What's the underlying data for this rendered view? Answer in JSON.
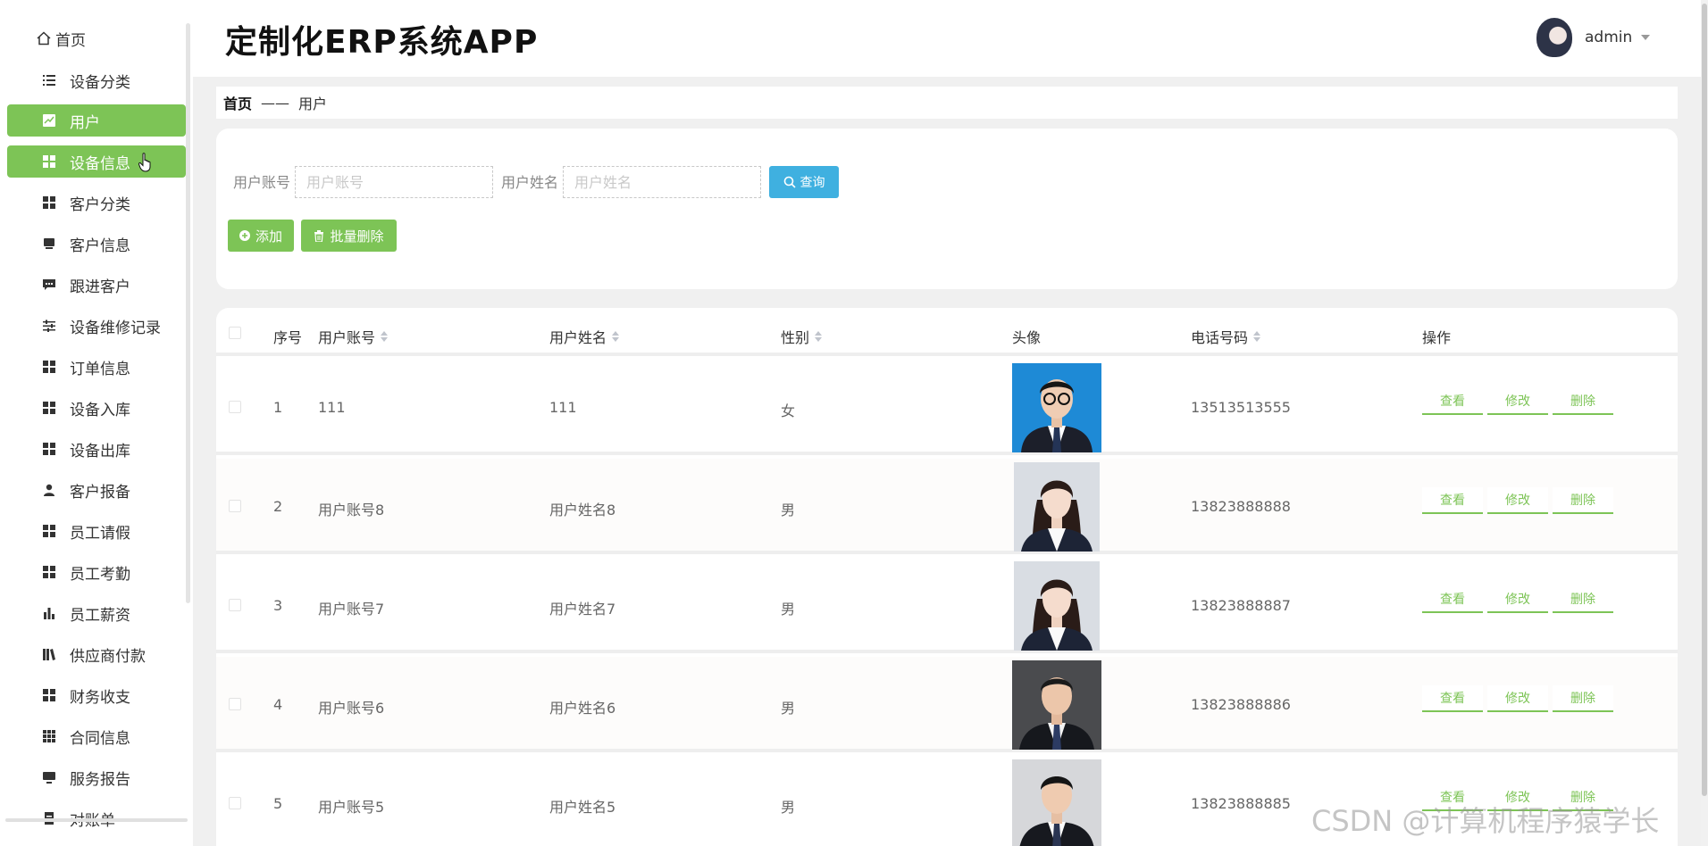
{
  "sidebar": {
    "home_label": "首页",
    "items": [
      {
        "label": "设备分类",
        "icon": "list-icon",
        "active": false
      },
      {
        "label": "用户",
        "icon": "chart-icon",
        "active": true
      },
      {
        "label": "设备信息",
        "icon": "grid-icon",
        "active": true
      },
      {
        "label": "客户分类",
        "icon": "grid-icon",
        "active": false
      },
      {
        "label": "客户信息",
        "icon": "inbox-icon",
        "active": false
      },
      {
        "label": "跟进客户",
        "icon": "message-icon",
        "active": false
      },
      {
        "label": "设备维修记录",
        "icon": "sliders-icon",
        "active": false
      },
      {
        "label": "订单信息",
        "icon": "grid-icon",
        "active": false
      },
      {
        "label": "设备入库",
        "icon": "grid-icon",
        "active": false
      },
      {
        "label": "设备出库",
        "icon": "grid-icon",
        "active": false
      },
      {
        "label": "客户报备",
        "icon": "person-icon",
        "active": false
      },
      {
        "label": "员工请假",
        "icon": "grid-icon",
        "active": false
      },
      {
        "label": "员工考勤",
        "icon": "grid-icon",
        "active": false
      },
      {
        "label": "员工薪资",
        "icon": "bar-chart-icon",
        "active": false
      },
      {
        "label": "供应商付款",
        "icon": "books-icon",
        "active": false
      },
      {
        "label": "财务收支",
        "icon": "grid-icon",
        "active": false
      },
      {
        "label": "合同信息",
        "icon": "apps-icon",
        "active": false
      },
      {
        "label": "服务报告",
        "icon": "monitor-icon",
        "active": false
      },
      {
        "label": "对账单",
        "icon": "document-icon",
        "active": false
      }
    ]
  },
  "header": {
    "title": "定制化ERP系统APP",
    "username": "admin"
  },
  "breadcrumb": {
    "home": "首页",
    "separator": "——",
    "current": "用户"
  },
  "search": {
    "account_label": "用户账号",
    "account_placeholder": "用户账号",
    "name_label": "用户姓名",
    "name_placeholder": "用户姓名",
    "query_label": "查询",
    "add_label": "添加",
    "batch_delete_label": "批量删除"
  },
  "table": {
    "columns": [
      "序号",
      "用户账号",
      "用户姓名",
      "性别",
      "头像",
      "电话号码",
      "操作"
    ],
    "sortable": [
      false,
      true,
      true,
      true,
      false,
      true,
      false
    ],
    "actions": {
      "view": "查看",
      "edit": "修改",
      "delete": "删除"
    },
    "rows": [
      {
        "index": "1",
        "account": "111",
        "name": "111",
        "gender": "女",
        "phone": "13513513555",
        "avatar": "blue-background-man-glasses"
      },
      {
        "index": "2",
        "account": "用户账号8",
        "name": "用户姓名8",
        "gender": "男",
        "phone": "13823888888",
        "avatar": "grey-background-woman"
      },
      {
        "index": "3",
        "account": "用户账号7",
        "name": "用户姓名7",
        "gender": "男",
        "phone": "13823888887",
        "avatar": "grey-background-woman"
      },
      {
        "index": "4",
        "account": "用户账号6",
        "name": "用户姓名6",
        "gender": "男",
        "phone": "13823888886",
        "avatar": "dark-background-man"
      },
      {
        "index": "5",
        "account": "用户账号5",
        "name": "用户姓名5",
        "gender": "男",
        "phone": "13823888885",
        "avatar": "grey-background-man"
      }
    ]
  },
  "watermark": "CSDN @计算机程序猿学长",
  "colors": {
    "accent_green": "#7dc456",
    "query_blue": "#3fb0e0",
    "page_background": "#f0f0f0"
  }
}
